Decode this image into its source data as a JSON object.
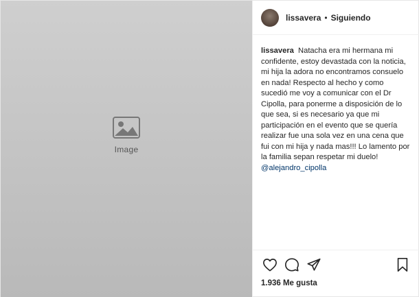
{
  "media": {
    "placeholder": "Image"
  },
  "header": {
    "username": "lissavera",
    "separator": "•",
    "follow_status": "Siguiendo"
  },
  "caption": {
    "author": "lissavera",
    "text": "Natacha era mi hermana mi confidente, estoy devastada con la noticia, mi hija la adora no encontramos consuelo en nada! Respecto al hecho y como sucedió me voy a comunicar con el Dr Cipolla, para ponerme a disposición de lo que sea, si es necesario ya que mi participación en el evento que se quería realizar fue una sola vez en una cena que fui con mi hija y nada mas!!! Lo lamento por la familia sepan respetar mi duelo!",
    "mention": "@alejandro_cipolla"
  },
  "actions": {
    "like_icon": "heart-icon",
    "comment_icon": "comment-icon",
    "share_icon": "share-icon",
    "save_icon": "bookmark-icon"
  },
  "likes": {
    "label": "1.936 Me gusta"
  }
}
